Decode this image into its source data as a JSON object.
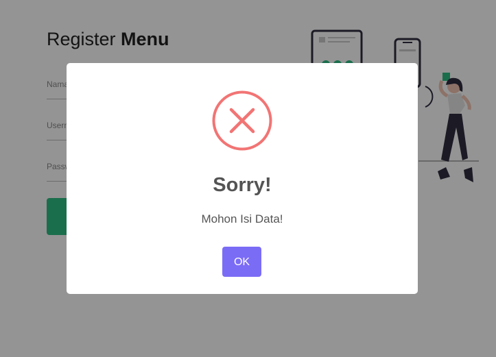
{
  "page": {
    "title_regular": "Register ",
    "title_bold": "Menu",
    "fields": [
      {
        "label": "Nama"
      },
      {
        "label": "Username"
      },
      {
        "label": "Password"
      }
    ],
    "submit_color": "#2ebd83"
  },
  "dialog": {
    "icon": "error-x-icon",
    "icon_color": "#f27474",
    "title": "Sorry!",
    "message": "Mohon Isi Data!",
    "ok_label": "OK",
    "ok_color": "#7b6cf6"
  },
  "colors": {
    "accent_green": "#2ebd83",
    "dark": "#2f2e41"
  }
}
